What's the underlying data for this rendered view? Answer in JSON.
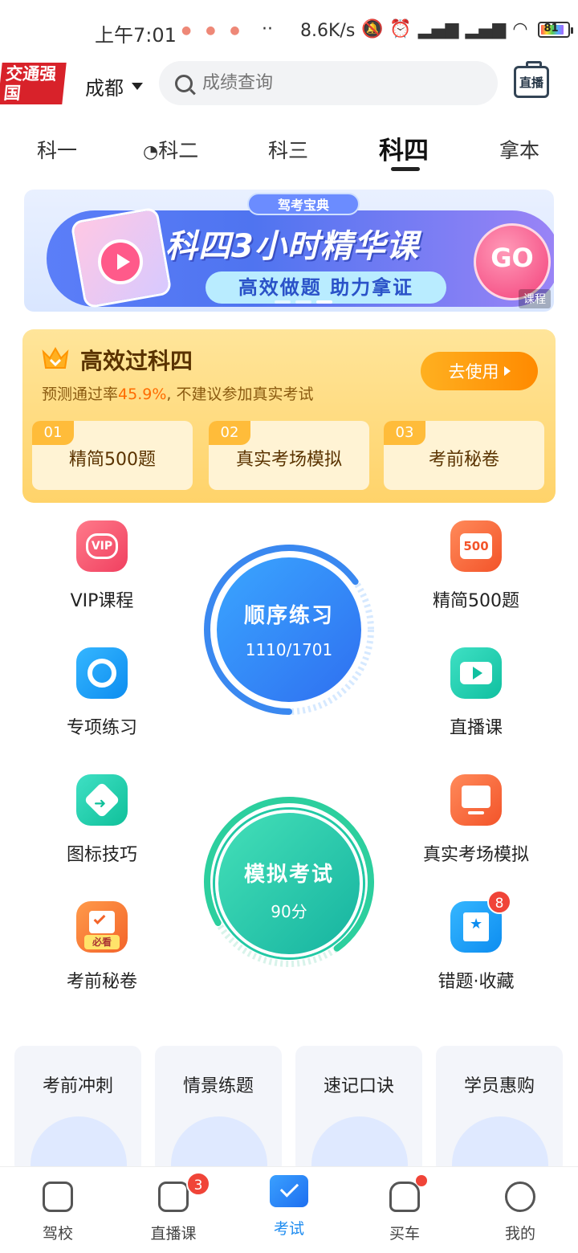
{
  "status_bar": {
    "time": "上午7:01",
    "more": "··",
    "speed": "8.6K/s",
    "battery": "81"
  },
  "header": {
    "logo_text": "交通强国",
    "city": "成都",
    "search_placeholder": "成绩查询",
    "live_label": "直播"
  },
  "tabs": [
    "科一",
    "科二",
    "科三",
    "科四",
    "拿本"
  ],
  "banner": {
    "brand": "驾考宝典",
    "title": "科四3小时精华课",
    "subtitle": "高效做题 助力拿证",
    "go": "GO",
    "tag": "课程"
  },
  "promo": {
    "title": "高效过科四",
    "subtitle_prefix": "预测通过率",
    "rate": "45.9%",
    "subtitle_suffix": ", 不建议参加真实考试",
    "button": "去使用",
    "items": [
      {
        "num": "01",
        "label": "精简500题"
      },
      {
        "num": "02",
        "label": "真实考场模拟"
      },
      {
        "num": "03",
        "label": "考前秘卷"
      }
    ]
  },
  "grid": {
    "vip": "VIP课程",
    "special": "专项练习",
    "signs": "图标技巧",
    "secret": "考前秘卷",
    "q500": "精简500题",
    "live": "直播课",
    "real": "真实考场模拟",
    "wrong": "错题·收藏",
    "wrong_badge": "8",
    "icon_vip": "VIP",
    "icon_500": "500",
    "icon_must": "必看"
  },
  "circles": {
    "seq_title": "顺序练习",
    "seq_value": "1110/1701",
    "seq_progress": 0.65,
    "mock_title": "模拟考试",
    "mock_value": "90分"
  },
  "cards": [
    "考前冲刺",
    "情景练题",
    "速记口诀",
    "学员惠购"
  ],
  "bottom_nav": [
    {
      "label": "驾校"
    },
    {
      "label": "直播课",
      "badge": "3"
    },
    {
      "label": "考试"
    },
    {
      "label": "买车"
    },
    {
      "label": "我的"
    }
  ]
}
